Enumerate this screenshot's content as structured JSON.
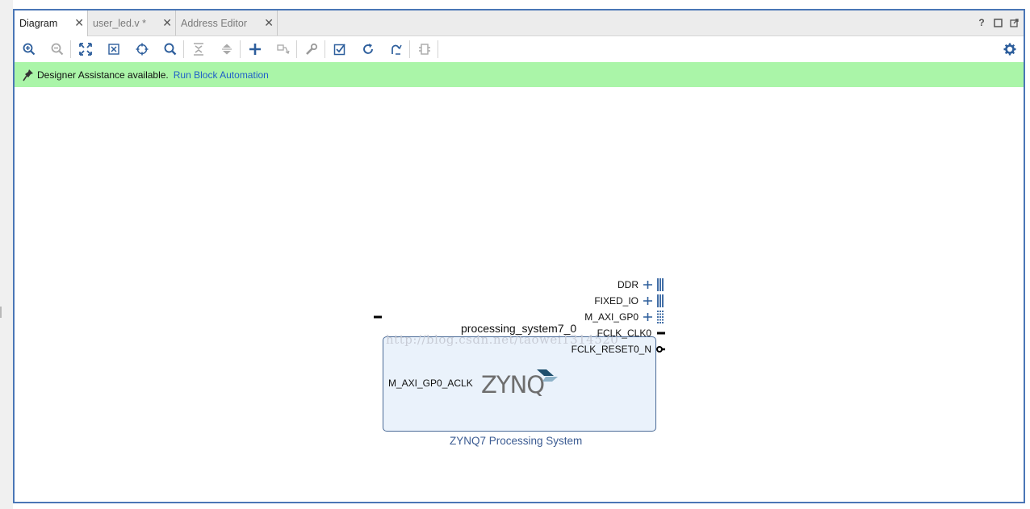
{
  "tabs": [
    {
      "label": "Diagram",
      "active": true
    },
    {
      "label": "user_led.v *",
      "active": false
    },
    {
      "label": "Address Editor",
      "active": false
    }
  ],
  "window_controls": [
    "help-icon",
    "restore-icon",
    "float-icon"
  ],
  "toolbar_icons": [
    "zoom-in-icon",
    "zoom-out-icon",
    "zoom-fit-icon",
    "fit-selection-icon",
    "autofit-icon",
    "search-icon",
    "collapse-all-icon",
    "expand-all-icon",
    "add-ip-icon",
    "make-connection-icon",
    "ip-settings-icon",
    "validate-design-icon",
    "refresh-icon",
    "regenerate-layout-icon",
    "create-hierarchy-icon",
    "settings-gear-icon"
  ],
  "assistance": {
    "message": "Designer Assistance available.",
    "link": "Run Block Automation"
  },
  "block": {
    "name": "processing_system7_0",
    "subtitle": "ZYNQ7 Processing System",
    "logo_text": "ZYNQ",
    "watermark": "http://blog.csdn.net/taowei1314520",
    "left_ports": [
      {
        "label": "M_AXI_GP0_ACLK"
      }
    ],
    "right_ports": [
      {
        "label": "DDR",
        "kind": "bus"
      },
      {
        "label": "FIXED_IO",
        "kind": "bus"
      },
      {
        "label": "M_AXI_GP0",
        "kind": "axi"
      },
      {
        "label": "FCLK_CLK0",
        "kind": "clock"
      },
      {
        "label": "FCLK_RESET0_N",
        "kind": "reset"
      }
    ]
  },
  "colors": {
    "frame_border": "#4a76b6",
    "assist_bar": "#aaf5a8",
    "link": "#1f5ec9",
    "block_fill": "#eaf2fb",
    "block_border": "#4a6a96",
    "subtitle": "#3b5b92",
    "icon_blue": "#2d5e9c"
  }
}
